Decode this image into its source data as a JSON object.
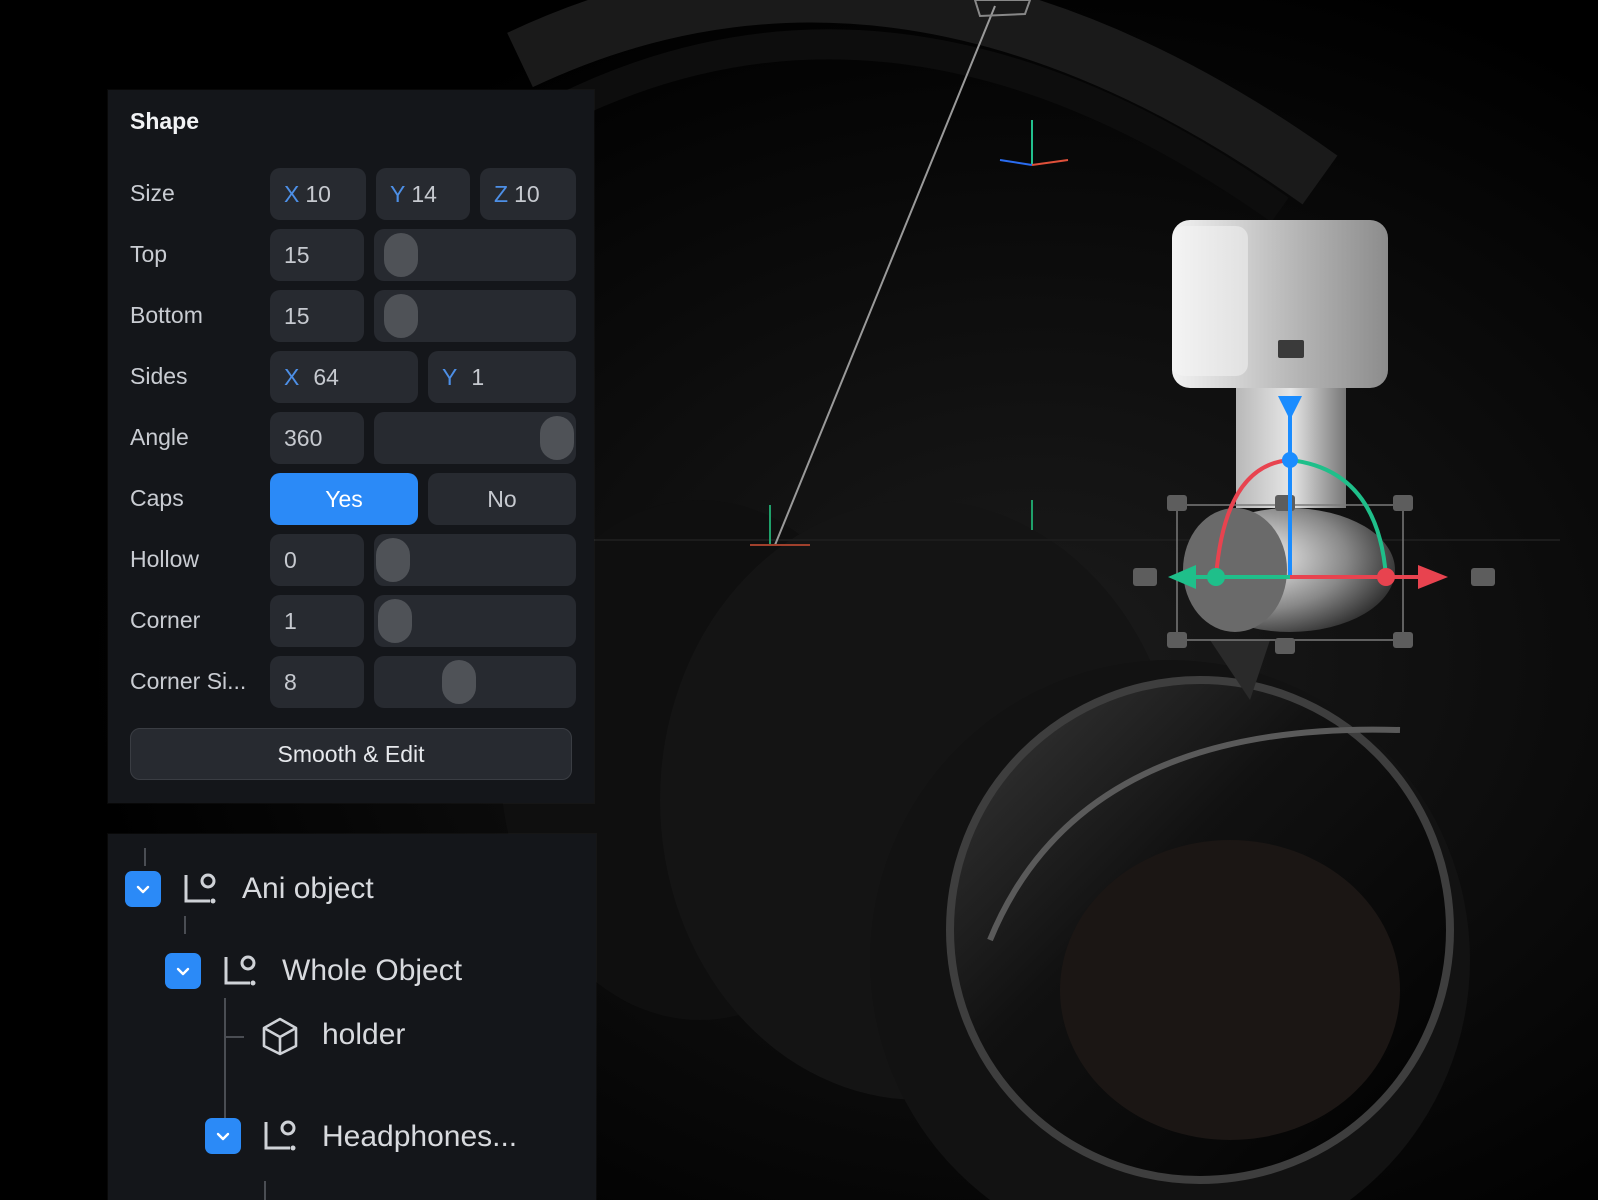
{
  "shape_panel": {
    "title": "Shape",
    "size": {
      "label": "Size",
      "x_axis": "X",
      "x": "10",
      "y_axis": "Y",
      "y": "14",
      "z_axis": "Z",
      "z": "10"
    },
    "top": {
      "label": "Top",
      "value": "15",
      "slider_fraction": 0.05
    },
    "bottom": {
      "label": "Bottom",
      "value": "15",
      "slider_fraction": 0.05
    },
    "sides": {
      "label": "Sides",
      "x_axis": "X",
      "x": "64",
      "y_axis": "Y",
      "y": "1"
    },
    "angle": {
      "label": "Angle",
      "value": "360",
      "slider_fraction": 1.0
    },
    "caps": {
      "label": "Caps",
      "yes_label": "Yes",
      "no_label": "No",
      "selected": "Yes"
    },
    "hollow": {
      "label": "Hollow",
      "value": "0",
      "slider_fraction": 0.0
    },
    "corner": {
      "label": "Corner",
      "value": "1",
      "slider_fraction": 0.01
    },
    "corner_size": {
      "label": "Corner Si...",
      "value": "8",
      "slider_fraction": 0.4
    },
    "smooth_button": "Smooth & Edit"
  },
  "tree": {
    "items": [
      {
        "label": "Ani object",
        "icon": "group-node-icon",
        "expanded": true
      },
      {
        "label": "Whole Object",
        "icon": "group-node-icon",
        "expanded": true
      },
      {
        "label": "holder",
        "icon": "cube-icon"
      },
      {
        "label": "Headphones...",
        "icon": "group-node-icon",
        "expanded": true
      }
    ]
  },
  "colors": {
    "accent": "#2b8af7",
    "panel": "#14161a",
    "field": "#272a30",
    "gizmo_x": "#e8434f",
    "gizmo_y": "#1fbf8a",
    "gizmo_z": "#1a8cff"
  }
}
